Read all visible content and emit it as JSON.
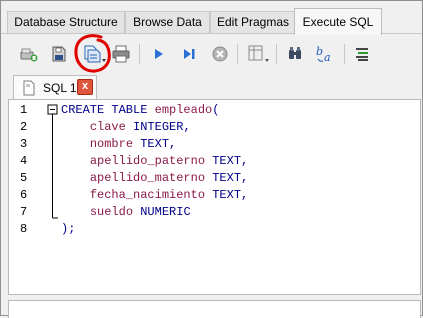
{
  "tabs": [
    {
      "label": "Database Structure",
      "active": false
    },
    {
      "label": "Browse Data",
      "active": false
    },
    {
      "label": "Edit Pragmas",
      "active": false
    },
    {
      "label": "Execute SQL",
      "active": true
    }
  ],
  "toolbar": {
    "buttons": [
      {
        "icon": "open-tab-icon"
      },
      {
        "icon": "open-sql-file-icon"
      },
      {
        "icon": "save-sql-file-icon"
      },
      {
        "icon": "print-icon"
      },
      {
        "icon": "execute-all-icon"
      },
      {
        "icon": "execute-current-line-icon"
      },
      {
        "icon": "stop-execution-icon"
      },
      {
        "icon": "save-results-icon"
      },
      {
        "icon": "find-icon"
      },
      {
        "icon": "find-replace-icon"
      },
      {
        "icon": "comment-lines-icon"
      }
    ]
  },
  "editor_tab": {
    "label": "SQL 1",
    "close_glyph": "x"
  },
  "editor": {
    "lines": [
      {
        "no": "1",
        "parts": [
          {
            "t": "CREATE TABLE ",
            "c": "kw"
          },
          {
            "t": "empleado",
            "c": "id"
          },
          {
            "t": "(",
            "c": "kw"
          }
        ]
      },
      {
        "no": "2",
        "parts": [
          {
            "t": "    ",
            "c": "kw"
          },
          {
            "t": "clave",
            "c": "id"
          },
          {
            "t": " INTEGER,",
            "c": "kw"
          }
        ]
      },
      {
        "no": "3",
        "parts": [
          {
            "t": "    ",
            "c": "kw"
          },
          {
            "t": "nombre",
            "c": "id"
          },
          {
            "t": " TEXT,",
            "c": "kw"
          }
        ]
      },
      {
        "no": "4",
        "parts": [
          {
            "t": "    ",
            "c": "kw"
          },
          {
            "t": "apellido_paterno",
            "c": "id"
          },
          {
            "t": " TEXT,",
            "c": "kw"
          }
        ]
      },
      {
        "no": "5",
        "parts": [
          {
            "t": "    ",
            "c": "kw"
          },
          {
            "t": "apellido_materno",
            "c": "id"
          },
          {
            "t": " TEXT,",
            "c": "kw"
          }
        ]
      },
      {
        "no": "6",
        "parts": [
          {
            "t": "    ",
            "c": "kw"
          },
          {
            "t": "fecha_nacimiento",
            "c": "id"
          },
          {
            "t": " TEXT,",
            "c": "kw"
          }
        ]
      },
      {
        "no": "7",
        "parts": [
          {
            "t": "    ",
            "c": "kw"
          },
          {
            "t": "sueldo",
            "c": "id"
          },
          {
            "t": " NUMERIC",
            "c": "kw"
          }
        ]
      },
      {
        "no": "8",
        "parts": [
          {
            "t": ");",
            "c": "kw"
          }
        ]
      }
    ]
  },
  "colors": {
    "keyword": "#00008b",
    "identifier": "#8b1a4a",
    "annotation_circle": "#e00000",
    "close_button": "#e0563d"
  }
}
